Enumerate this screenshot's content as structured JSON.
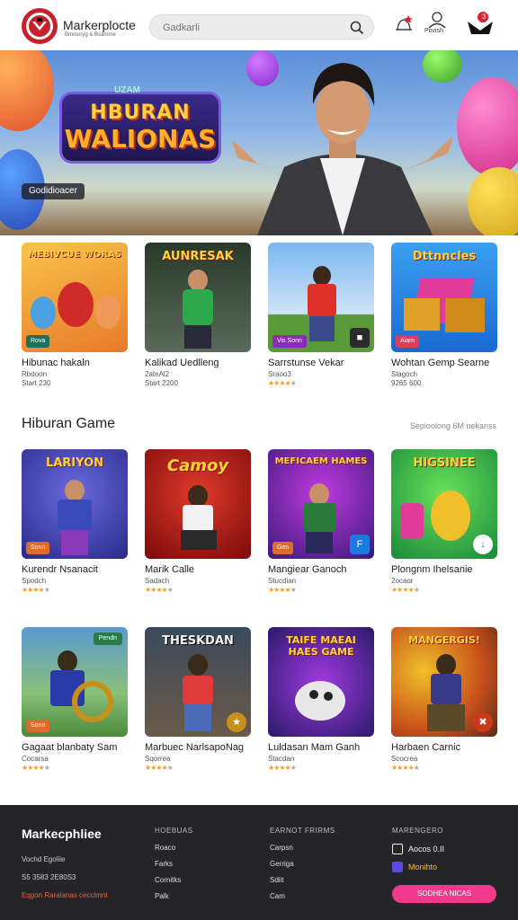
{
  "header": {
    "logo_text": "Markerplocte",
    "logo_sub": "Bmmoryg & Bsamme",
    "search_placeholder": "Gadkarli",
    "profile_label": "Povish",
    "cart_badge": "3"
  },
  "hero": {
    "title_top": "UZAM",
    "title_line1": "HBURAN",
    "title_line2": "WALIONAS",
    "badge": "Godidioacer"
  },
  "top_row": [
    {
      "name": "Hibunac hakaln",
      "sub1": "Rbdoon",
      "sub2": "Start 230",
      "tag": "Rova",
      "thumb_title": "MEBIVCUE WORAS",
      "color": "#f3b23a"
    },
    {
      "name": "Kalikad Uedlleng",
      "sub1": "2ateAl2",
      "sub2": "Start 2200",
      "tag": "",
      "thumb_title": "AUNRESAK",
      "color": "#3a4a3a"
    },
    {
      "name": "Sarrstunse Vekar",
      "sub1": "Sraoo3",
      "rating": 4,
      "tag": "Vis Sonn",
      "thumb_title": "",
      "color": "#5aa0e0"
    },
    {
      "name": "Wohtan Gemp Searne",
      "sub1": "Slagoch",
      "sub2": "9265 600",
      "tag": "Aiam",
      "thumb_title": "Dttnncles",
      "color": "#2a86e0"
    }
  ],
  "section": {
    "title": "Hiburan Game",
    "link": "Sepioolong 6M nekanss"
  },
  "game_rows": [
    [
      {
        "name": "Kurendr Nsanacit",
        "sub1": "Spodch",
        "rating": 4,
        "tag": "Sonn",
        "thumb_title": "LARIYON",
        "color": "#3a3aa8"
      },
      {
        "name": "Marik Calle",
        "sub1": "Sadach",
        "rating": 4,
        "tag": "",
        "thumb_title": "Camoy",
        "color": "#b81a1a"
      },
      {
        "name": "Mangiear Ganoch",
        "sub1": "Stucdian",
        "rating": 4,
        "tag": "Gen",
        "thumb_title": "MEFICAEM HAMES",
        "color": "#6a2aa8"
      },
      {
        "name": "Plongnm Ihelsanie",
        "sub1": "2ocaor",
        "rating": 4,
        "tag": "",
        "thumb_title": "HIGSINEE",
        "color": "#3aa84a"
      }
    ],
    [
      {
        "name": "Gagaat blanbaty Sam",
        "sub1": "Cocarsa",
        "rating": 4,
        "tag": "Sonn",
        "thumb_title": "",
        "color": "#4a8a3a",
        "pill": "Pendn"
      },
      {
        "name": "Marbuec NarlsapoNag",
        "sub1": "Sqorrea",
        "rating": 4,
        "tag": "",
        "thumb_title": "THESKDAN",
        "color": "#4a5a6a"
      },
      {
        "name": "Luldasan Mam Ganh",
        "sub1": "Stacdan",
        "rating": 4,
        "tag": "",
        "thumb_title": "TAIFE MAEAI HAES GAME",
        "color": "#5a2aa8"
      },
      {
        "name": "Harbaen Carnic",
        "sub1": "Scocrea",
        "rating": 4,
        "tag": "",
        "thumb_title": "MANGERGIS!",
        "color": "#c8701a"
      }
    ]
  ],
  "footer": {
    "brand": "Markecphliee",
    "line1": "Vochd Egoliie",
    "line2": "S5 3583 2E80S3",
    "line3": "Eqgon Raralanas cecclmnt",
    "col1": {
      "title": "HOEBUAS",
      "items": [
        "Roaco",
        "Farks",
        "Cornitks",
        "Palk"
      ]
    },
    "col2": {
      "title": "EARNOT FRIRMS",
      "items": [
        "Carpsn",
        "Gerriga",
        "Sdiit",
        "Cam"
      ]
    },
    "col3": {
      "title": "MARENGERO"
    },
    "social1": "Aocos 0.II",
    "social2": "Monihto",
    "button": "SODHEA NICAS"
  }
}
